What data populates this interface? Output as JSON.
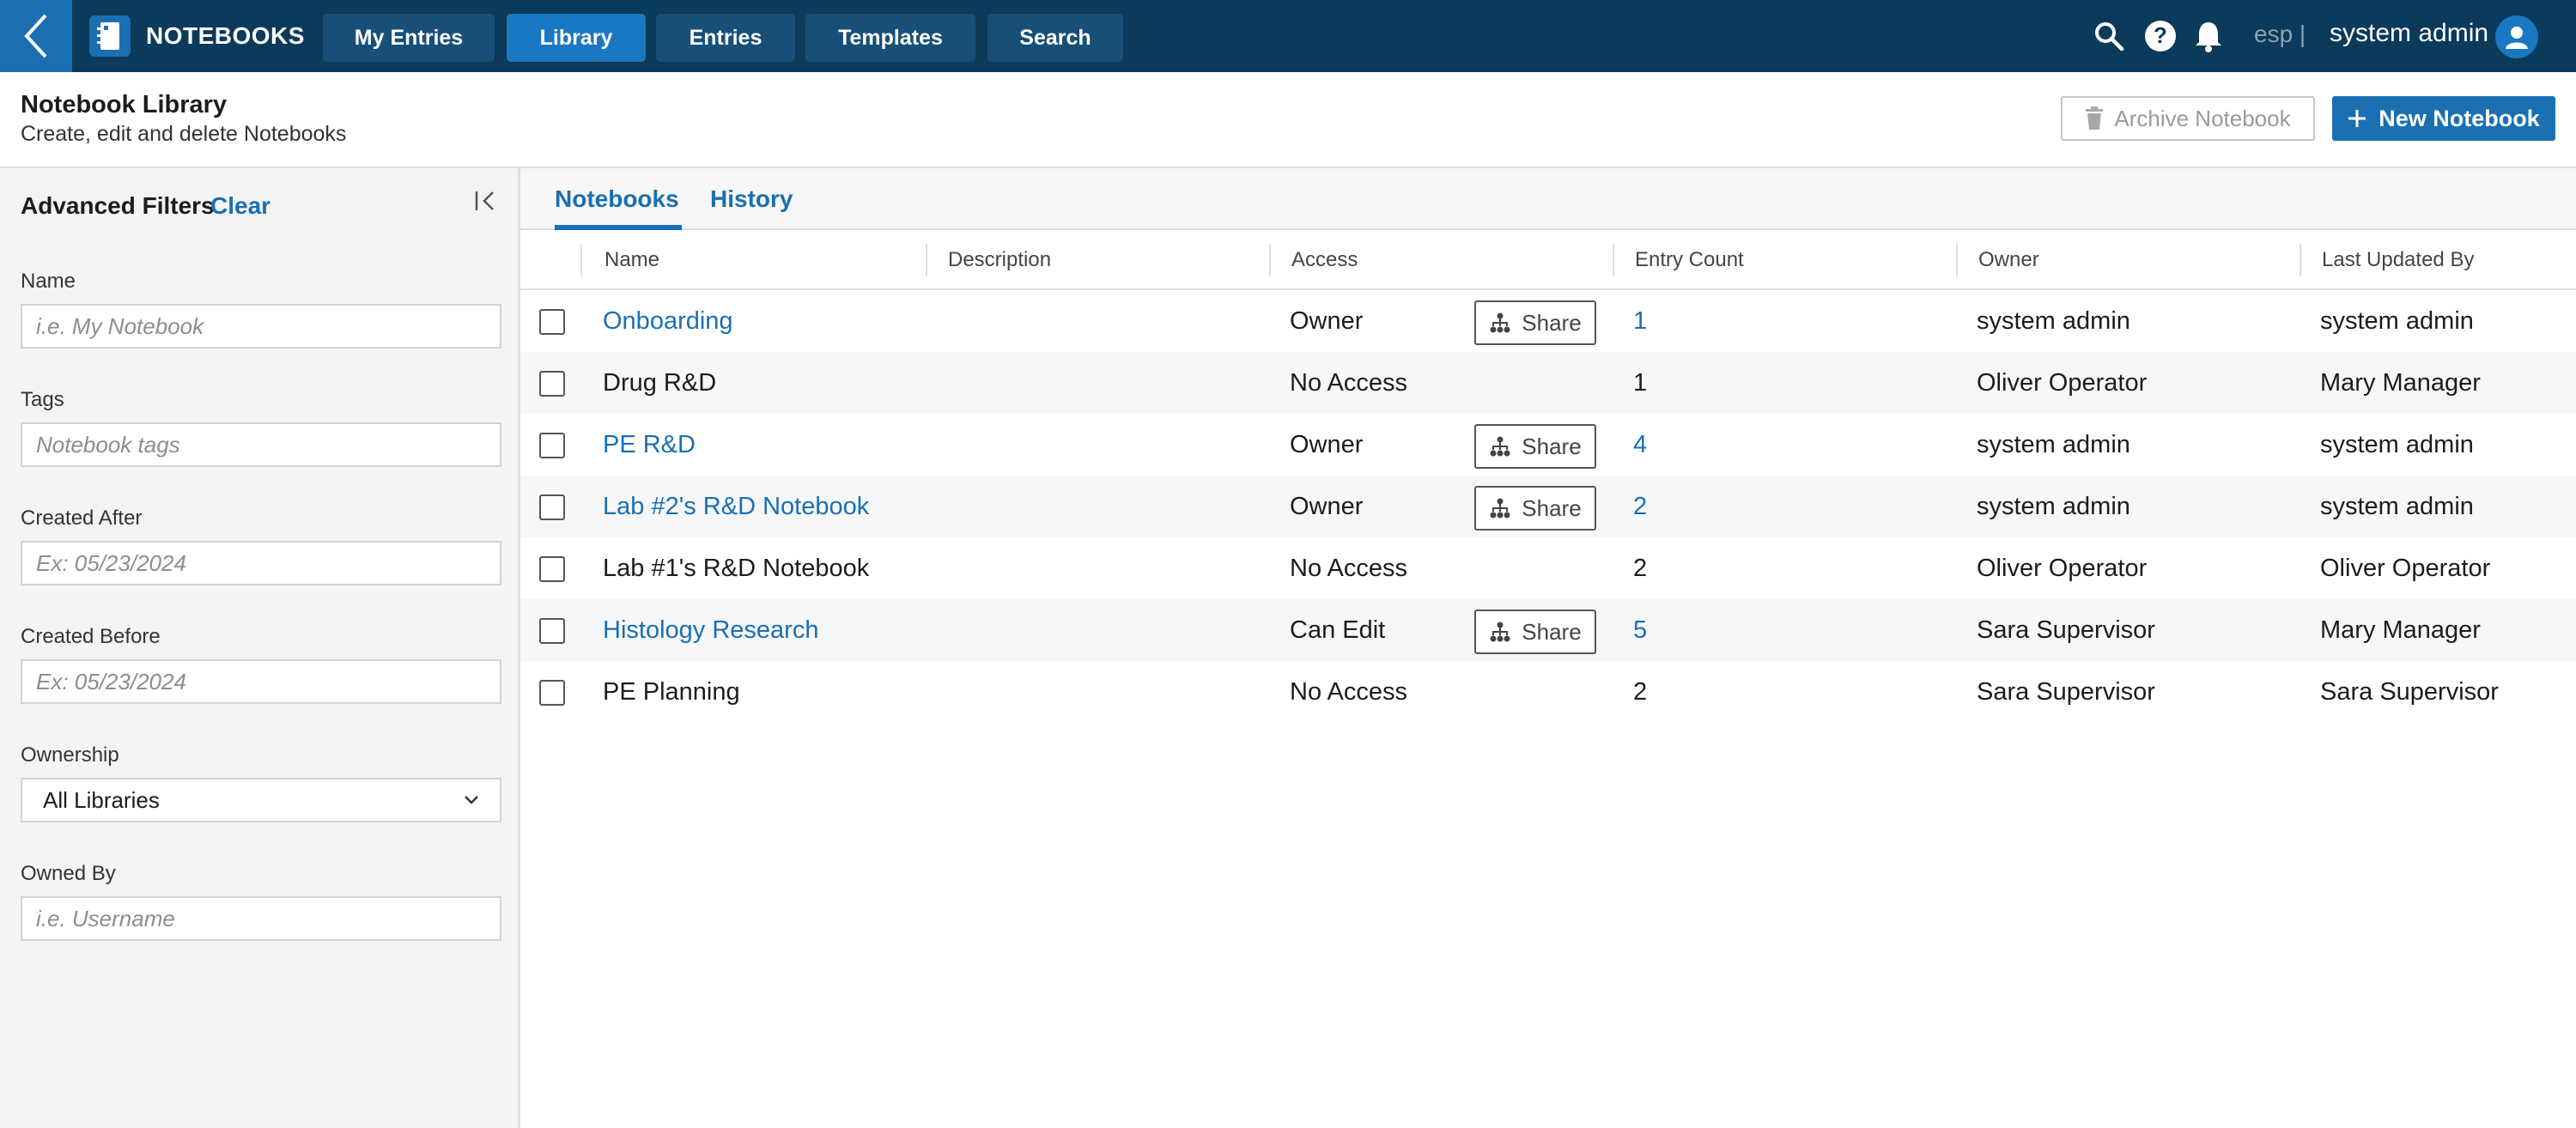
{
  "app": {
    "brand": "NOTEBOOKS",
    "nav_tabs": [
      {
        "label": "My Entries",
        "active": false
      },
      {
        "label": "Library",
        "active": true
      },
      {
        "label": "Entries",
        "active": false
      },
      {
        "label": "Templates",
        "active": false
      },
      {
        "label": "Search",
        "active": false
      }
    ],
    "language": "esp |",
    "user": "system admin"
  },
  "header": {
    "title": "Notebook Library",
    "subtitle": "Create, edit and delete Notebooks",
    "archive_label": "Archive Notebook",
    "new_label": "New Notebook"
  },
  "filters": {
    "title": "Advanced Filters",
    "clear": "Clear",
    "name_label": "Name",
    "name_placeholder": "i.e. My Notebook",
    "tags_label": "Tags",
    "tags_placeholder": "Notebook tags",
    "created_after_label": "Created After",
    "created_after_placeholder": "Ex: 05/23/2024",
    "created_before_label": "Created Before",
    "created_before_placeholder": "Ex: 05/23/2024",
    "ownership_label": "Ownership",
    "ownership_value": "All Libraries",
    "owned_by_label": "Owned By",
    "owned_by_placeholder": "i.e. Username"
  },
  "tabs": [
    "Notebooks",
    "History"
  ],
  "table": {
    "columns": [
      "Name",
      "Description",
      "Access",
      "Entry Count",
      "Owner",
      "Last Updated By"
    ],
    "share_label": "Share",
    "rows": [
      {
        "name": "Onboarding",
        "description": "",
        "access": "Owner",
        "entry_count": "1",
        "owner": "system admin",
        "last_updated_by": "system admin",
        "link": true,
        "share": true
      },
      {
        "name": "Drug R&D",
        "description": "",
        "access": "No Access",
        "entry_count": "1",
        "owner": "Oliver Operator",
        "last_updated_by": "Mary Manager",
        "link": false,
        "share": false
      },
      {
        "name": "PE R&D",
        "description": "",
        "access": "Owner",
        "entry_count": "4",
        "owner": "system admin",
        "last_updated_by": "system admin",
        "link": true,
        "share": true
      },
      {
        "name": "Lab #2's R&D Notebook",
        "description": "",
        "access": "Owner",
        "entry_count": "2",
        "owner": "system admin",
        "last_updated_by": "system admin",
        "link": true,
        "share": true
      },
      {
        "name": "Lab #1's R&D Notebook",
        "description": "",
        "access": "No Access",
        "entry_count": "2",
        "owner": "Oliver Operator",
        "last_updated_by": "Oliver Operator",
        "link": false,
        "share": false
      },
      {
        "name": "Histology Research",
        "description": "",
        "access": "Can Edit",
        "entry_count": "5",
        "owner": "Sara Supervisor",
        "last_updated_by": "Mary Manager",
        "link": true,
        "share": true
      },
      {
        "name": "PE Planning",
        "description": "",
        "access": "No Access",
        "entry_count": "2",
        "owner": "Sara Supervisor",
        "last_updated_by": "Sara Supervisor",
        "link": false,
        "share": false
      }
    ]
  },
  "colors": {
    "topbar": "#0b3a5a",
    "accent": "#1a6fb2",
    "nav_tab": "#174f78",
    "nav_tab_active": "#1a78c2"
  },
  "icons": [
    "back-chevron-icon",
    "notebook-icon",
    "search-icon",
    "help-icon",
    "bell-icon",
    "user-icon",
    "trash-icon",
    "plus-icon",
    "collapse-left-icon",
    "chevron-down-icon",
    "share-hierarchy-icon"
  ]
}
